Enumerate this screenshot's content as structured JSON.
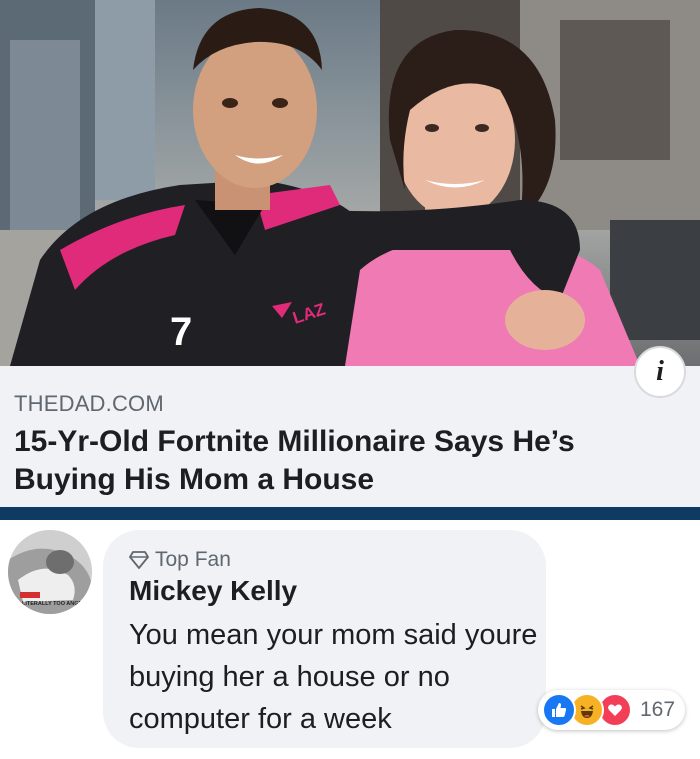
{
  "link_preview": {
    "domain": "THEDAD.COM",
    "headline": "15-Yr-Old Fortnite Millionaire Says He’s Buying His Mom a House",
    "info_icon": "info-icon",
    "info_glyph": "i",
    "jersey_number": "7",
    "jersey_brand": "LAZ"
  },
  "comment": {
    "badge_icon": "diamond-icon",
    "badge_label": "Top Fan",
    "author": "Mickey Kelly",
    "text": "You mean your mom said youre buying her a house or no computer for a week",
    "avatar_caption": "LITERALLY TOO ANGRY"
  },
  "reactions": {
    "icons": [
      "like-icon",
      "haha-icon",
      "love-icon"
    ],
    "count": "167"
  },
  "colors": {
    "accent_bar": "#0f3b63",
    "like": "#1877f2",
    "haha": "#f7b125",
    "love": "#f33e58"
  }
}
